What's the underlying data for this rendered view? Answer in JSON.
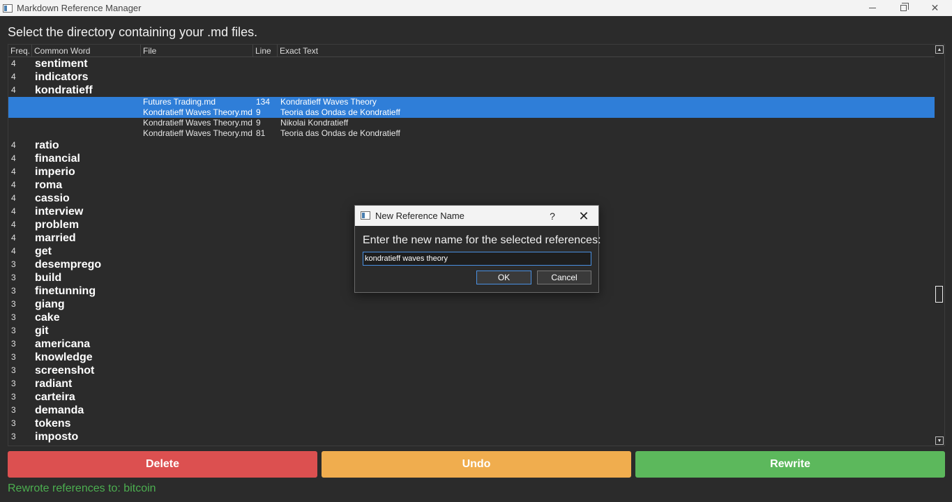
{
  "window": {
    "title": "Markdown Reference Manager",
    "minimize_icon": "minimize-icon",
    "maximize_icon": "restore-icon",
    "close_glyph": "✕"
  },
  "instruction": "Select the directory containing your .md files.",
  "tree": {
    "headers": {
      "freq": "Freq.",
      "word": "Common Word",
      "file": "File",
      "line": "Line",
      "text": "Exact Text"
    },
    "rows": [
      {
        "kind": "word",
        "freq": "4",
        "word": "sentiment"
      },
      {
        "kind": "word",
        "freq": "4",
        "word": "indicators"
      },
      {
        "kind": "word",
        "freq": "4",
        "word": "kondratieff"
      },
      {
        "kind": "child",
        "file": "Futures Trading.md",
        "line": "134",
        "text": "Kondratieff Waves Theory",
        "selected": true
      },
      {
        "kind": "child",
        "file": "Kondratieff Waves Theory.md",
        "line": "9",
        "text": "Teoria das Ondas de Kondratieff",
        "selected": true
      },
      {
        "kind": "child",
        "file": "Kondratieff Waves Theory.md",
        "line": "9",
        "text": "Nikolai Kondratieff",
        "selected": false
      },
      {
        "kind": "child",
        "file": "Kondratieff Waves Theory.md",
        "line": "81",
        "text": "Teoria das Ondas de Kondratieff",
        "selected": false
      },
      {
        "kind": "word",
        "freq": "4",
        "word": "ratio"
      },
      {
        "kind": "word",
        "freq": "4",
        "word": "financial"
      },
      {
        "kind": "word",
        "freq": "4",
        "word": "imperio"
      },
      {
        "kind": "word",
        "freq": "4",
        "word": "roma"
      },
      {
        "kind": "word",
        "freq": "4",
        "word": "cassio"
      },
      {
        "kind": "word",
        "freq": "4",
        "word": "interview"
      },
      {
        "kind": "word",
        "freq": "4",
        "word": "problem"
      },
      {
        "kind": "word",
        "freq": "4",
        "word": "married"
      },
      {
        "kind": "word",
        "freq": "4",
        "word": "get"
      },
      {
        "kind": "word",
        "freq": "3",
        "word": "desemprego"
      },
      {
        "kind": "word",
        "freq": "3",
        "word": "build"
      },
      {
        "kind": "word",
        "freq": "3",
        "word": "finetunning"
      },
      {
        "kind": "word",
        "freq": "3",
        "word": "giang"
      },
      {
        "kind": "word",
        "freq": "3",
        "word": "cake"
      },
      {
        "kind": "word",
        "freq": "3",
        "word": "git"
      },
      {
        "kind": "word",
        "freq": "3",
        "word": "americana"
      },
      {
        "kind": "word",
        "freq": "3",
        "word": "knowledge"
      },
      {
        "kind": "word",
        "freq": "3",
        "word": "screenshot"
      },
      {
        "kind": "word",
        "freq": "3",
        "word": "radiant"
      },
      {
        "kind": "word",
        "freq": "3",
        "word": "carteira"
      },
      {
        "kind": "word",
        "freq": "3",
        "word": "demanda"
      },
      {
        "kind": "word",
        "freq": "3",
        "word": "tokens"
      },
      {
        "kind": "word",
        "freq": "3",
        "word": "imposto"
      }
    ],
    "scrollbar": {
      "up_icon": "▲",
      "down_icon": "▼"
    },
    "selection_color": "#2f7ed8"
  },
  "buttons": {
    "delete": "Delete",
    "undo": "Undo",
    "rewrite": "Rewrite",
    "colors": {
      "delete": "#dc5050",
      "undo": "#f0ad4e",
      "rewrite": "#5cb85c"
    }
  },
  "status": "Rewrote references to: bitcoin",
  "status_color": "#4caf50",
  "dialog": {
    "title": "New Reference Name",
    "help_glyph": "?",
    "close_glyph": "✕",
    "label": "Enter the new name for the selected references:",
    "input_value": "kondratieff waves theory",
    "ok": "OK",
    "cancel": "Cancel"
  }
}
